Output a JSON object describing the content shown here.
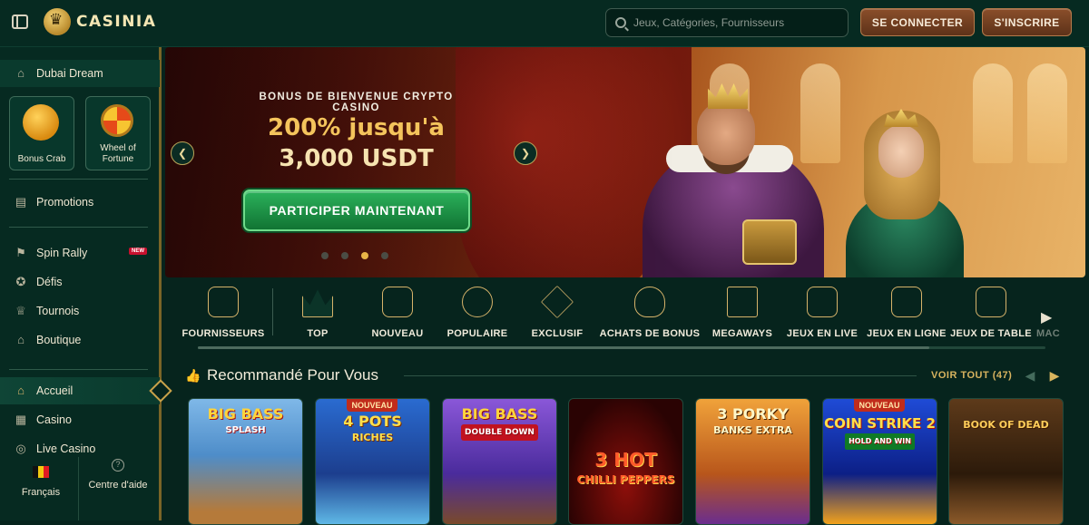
{
  "header": {
    "logo_text": "CASINIA",
    "search_placeholder": "Jeux, Catégories, Fournisseurs",
    "login_label": "SE CONNECTER",
    "signup_label": "S'INSCRIRE"
  },
  "sidebar": {
    "featured": "Dubai Dream",
    "tiles": [
      {
        "label": "Bonus Crab"
      },
      {
        "label": "Wheel of Fortune"
      }
    ],
    "promotions": "Promotions",
    "group1": [
      {
        "label": "Spin Rally",
        "badge": "NEW"
      },
      {
        "label": "Défis"
      },
      {
        "label": "Tournois"
      },
      {
        "label": "Boutique"
      }
    ],
    "group2": [
      {
        "label": "Accueil",
        "active": true
      },
      {
        "label": "Casino"
      },
      {
        "label": "Live Casino"
      }
    ],
    "language": "Français",
    "help": "Centre d'aide"
  },
  "banner": {
    "eyebrow": "BONUS DE BIENVENUE CRYPTO CASINO",
    "title_line1": "200% jusqu'à",
    "title_line2": "3,000 USDT",
    "cta": "PARTICIPER MAINTENANT",
    "prev_icon": "❮",
    "next_icon": "❯",
    "active_dot": 3,
    "dot_count": 4
  },
  "categories": [
    {
      "label": "FOURNISSEURS",
      "icon": "scroll-icon"
    },
    {
      "label": "TOP",
      "icon": "crown-icon"
    },
    {
      "label": "NOUVEAU",
      "icon": "new-chest-icon"
    },
    {
      "label": "POPULAIRE",
      "icon": "chip-icon"
    },
    {
      "label": "EXCLUSIF",
      "icon": "diamond-icon"
    },
    {
      "label": "ACHATS DE BONUS",
      "icon": "money-bag-icon"
    },
    {
      "label": "MEGAWAYS",
      "icon": "megaways-icon"
    },
    {
      "label": "JEUX EN LIVE",
      "icon": "live-cards-icon"
    },
    {
      "label": "JEUX EN LIGNE",
      "icon": "joystick-icon"
    },
    {
      "label": "JEUX DE TABLE",
      "icon": "table-cards-icon"
    },
    {
      "label": "MAC",
      "icon": "more-icon"
    }
  ],
  "recommended": {
    "title": "Recommandé Pour Vous",
    "view_all": "VOIR TOUT (47)",
    "games": [
      {
        "title": "BIG BASS",
        "subtitle": "SPLASH",
        "tag": ""
      },
      {
        "title": "4 POTS",
        "subtitle": "RICHES",
        "tag": "NOUVEAU"
      },
      {
        "title": "BIG BASS",
        "subtitle": "DOUBLE DOWN",
        "tag": ""
      },
      {
        "title": "3 HOT",
        "subtitle": "CHILLI PEPPERS",
        "tag": ""
      },
      {
        "title": "3 PORKY",
        "subtitle": "BANKS EXTRA",
        "tag": ""
      },
      {
        "title": "COIN STRIKE 2",
        "subtitle": "HOLD AND WIN",
        "tag": "NOUVEAU"
      },
      {
        "title": "BOOK OF DEAD",
        "subtitle": "",
        "tag": ""
      }
    ]
  },
  "colors": {
    "bg": "#06241d",
    "gold": "#d7b35f",
    "cta_green": "#1f9a49",
    "brown_button": "#6e3d21"
  }
}
